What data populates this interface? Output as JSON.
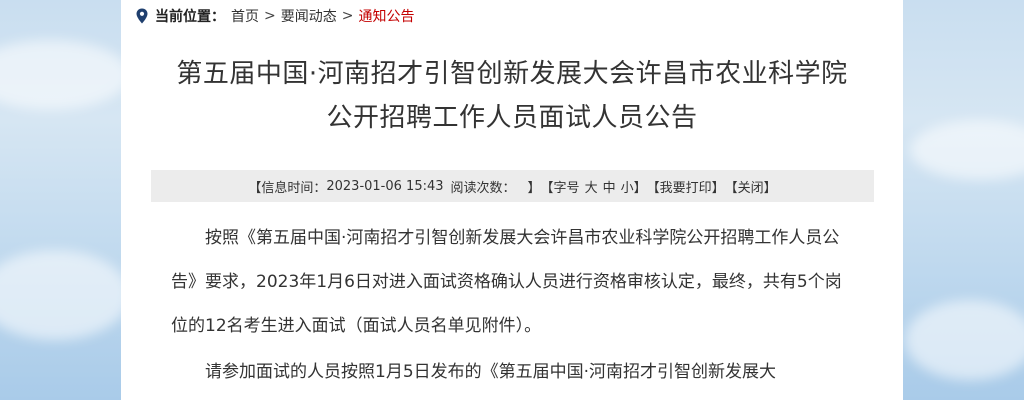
{
  "breadcrumb": {
    "label": "当前位置：",
    "home": "首页",
    "sep1": ">",
    "section": "要闻动态",
    "sep2": ">",
    "current": "通知公告"
  },
  "article": {
    "title_line1": "第五届中国·河南招才引智创新发展大会许昌市农业科学院",
    "title_line2": "公开招聘工作人员面试人员公告",
    "meta": {
      "info_prefix": "【信息时间：",
      "datetime": "2023-01-06 15:43",
      "views_label": "阅读次数：",
      "views_close": "】",
      "font_open": "【字号",
      "font_large": "大",
      "font_medium": "中",
      "font_small": "小】",
      "print": "【我要打印】",
      "close": "【关闭】"
    },
    "paragraphs": [
      "按照《第五届中国·河南招才引智创新发展大会许昌市农业科学院公开招聘工作人员公告》要求，2023年1月6日对进入面试资格确认人员进行资格审核认定，最终，共有5个岗位的12名考生进入面试（面试人员名单见附件）。",
      "请参加面试的人员按照1月5日发布的《第五届中国·河南招才引智创新发展大"
    ]
  },
  "colors": {
    "breadcrumb_current": "#c40000",
    "meta_bg": "#ececec",
    "pin": "#1f3f6e"
  },
  "icons": {
    "location": "location-pin-icon"
  }
}
